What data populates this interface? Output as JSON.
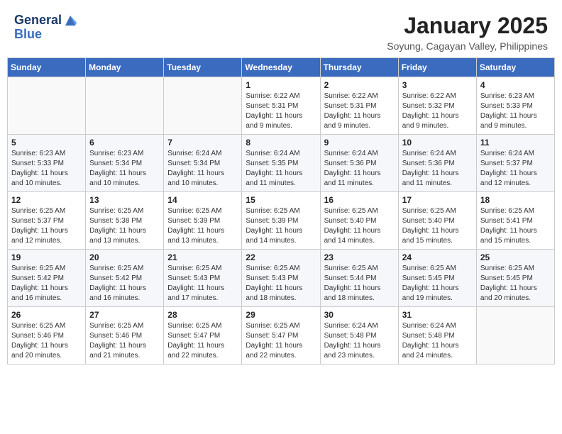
{
  "header": {
    "logo_line1": "General",
    "logo_line2": "Blue",
    "month_title": "January 2025",
    "subtitle": "Soyung, Cagayan Valley, Philippines"
  },
  "weekdays": [
    "Sunday",
    "Monday",
    "Tuesday",
    "Wednesday",
    "Thursday",
    "Friday",
    "Saturday"
  ],
  "weeks": [
    [
      {
        "day": "",
        "content": ""
      },
      {
        "day": "",
        "content": ""
      },
      {
        "day": "",
        "content": ""
      },
      {
        "day": "1",
        "content": "Sunrise: 6:22 AM\nSunset: 5:31 PM\nDaylight: 11 hours and 9 minutes."
      },
      {
        "day": "2",
        "content": "Sunrise: 6:22 AM\nSunset: 5:31 PM\nDaylight: 11 hours and 9 minutes."
      },
      {
        "day": "3",
        "content": "Sunrise: 6:22 AM\nSunset: 5:32 PM\nDaylight: 11 hours and 9 minutes."
      },
      {
        "day": "4",
        "content": "Sunrise: 6:23 AM\nSunset: 5:33 PM\nDaylight: 11 hours and 9 minutes."
      }
    ],
    [
      {
        "day": "5",
        "content": "Sunrise: 6:23 AM\nSunset: 5:33 PM\nDaylight: 11 hours and 10 minutes."
      },
      {
        "day": "6",
        "content": "Sunrise: 6:23 AM\nSunset: 5:34 PM\nDaylight: 11 hours and 10 minutes."
      },
      {
        "day": "7",
        "content": "Sunrise: 6:24 AM\nSunset: 5:34 PM\nDaylight: 11 hours and 10 minutes."
      },
      {
        "day": "8",
        "content": "Sunrise: 6:24 AM\nSunset: 5:35 PM\nDaylight: 11 hours and 11 minutes."
      },
      {
        "day": "9",
        "content": "Sunrise: 6:24 AM\nSunset: 5:36 PM\nDaylight: 11 hours and 11 minutes."
      },
      {
        "day": "10",
        "content": "Sunrise: 6:24 AM\nSunset: 5:36 PM\nDaylight: 11 hours and 11 minutes."
      },
      {
        "day": "11",
        "content": "Sunrise: 6:24 AM\nSunset: 5:37 PM\nDaylight: 11 hours and 12 minutes."
      }
    ],
    [
      {
        "day": "12",
        "content": "Sunrise: 6:25 AM\nSunset: 5:37 PM\nDaylight: 11 hours and 12 minutes."
      },
      {
        "day": "13",
        "content": "Sunrise: 6:25 AM\nSunset: 5:38 PM\nDaylight: 11 hours and 13 minutes."
      },
      {
        "day": "14",
        "content": "Sunrise: 6:25 AM\nSunset: 5:39 PM\nDaylight: 11 hours and 13 minutes."
      },
      {
        "day": "15",
        "content": "Sunrise: 6:25 AM\nSunset: 5:39 PM\nDaylight: 11 hours and 14 minutes."
      },
      {
        "day": "16",
        "content": "Sunrise: 6:25 AM\nSunset: 5:40 PM\nDaylight: 11 hours and 14 minutes."
      },
      {
        "day": "17",
        "content": "Sunrise: 6:25 AM\nSunset: 5:40 PM\nDaylight: 11 hours and 15 minutes."
      },
      {
        "day": "18",
        "content": "Sunrise: 6:25 AM\nSunset: 5:41 PM\nDaylight: 11 hours and 15 minutes."
      }
    ],
    [
      {
        "day": "19",
        "content": "Sunrise: 6:25 AM\nSunset: 5:42 PM\nDaylight: 11 hours and 16 minutes."
      },
      {
        "day": "20",
        "content": "Sunrise: 6:25 AM\nSunset: 5:42 PM\nDaylight: 11 hours and 16 minutes."
      },
      {
        "day": "21",
        "content": "Sunrise: 6:25 AM\nSunset: 5:43 PM\nDaylight: 11 hours and 17 minutes."
      },
      {
        "day": "22",
        "content": "Sunrise: 6:25 AM\nSunset: 5:43 PM\nDaylight: 11 hours and 18 minutes."
      },
      {
        "day": "23",
        "content": "Sunrise: 6:25 AM\nSunset: 5:44 PM\nDaylight: 11 hours and 18 minutes."
      },
      {
        "day": "24",
        "content": "Sunrise: 6:25 AM\nSunset: 5:45 PM\nDaylight: 11 hours and 19 minutes."
      },
      {
        "day": "25",
        "content": "Sunrise: 6:25 AM\nSunset: 5:45 PM\nDaylight: 11 hours and 20 minutes."
      }
    ],
    [
      {
        "day": "26",
        "content": "Sunrise: 6:25 AM\nSunset: 5:46 PM\nDaylight: 11 hours and 20 minutes."
      },
      {
        "day": "27",
        "content": "Sunrise: 6:25 AM\nSunset: 5:46 PM\nDaylight: 11 hours and 21 minutes."
      },
      {
        "day": "28",
        "content": "Sunrise: 6:25 AM\nSunset: 5:47 PM\nDaylight: 11 hours and 22 minutes."
      },
      {
        "day": "29",
        "content": "Sunrise: 6:25 AM\nSunset: 5:47 PM\nDaylight: 11 hours and 22 minutes."
      },
      {
        "day": "30",
        "content": "Sunrise: 6:24 AM\nSunset: 5:48 PM\nDaylight: 11 hours and 23 minutes."
      },
      {
        "day": "31",
        "content": "Sunrise: 6:24 AM\nSunset: 5:48 PM\nDaylight: 11 hours and 24 minutes."
      },
      {
        "day": "",
        "content": ""
      }
    ]
  ]
}
